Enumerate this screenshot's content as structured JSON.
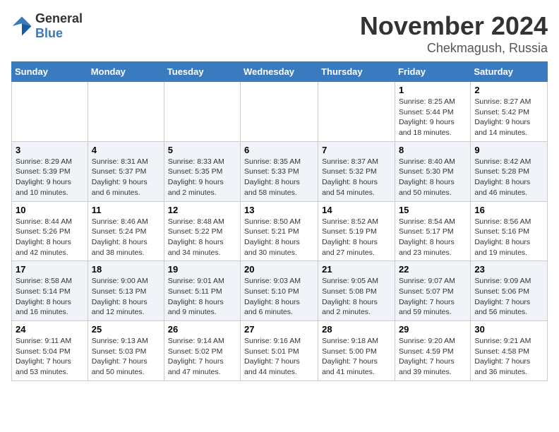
{
  "logo": {
    "general": "General",
    "blue": "Blue"
  },
  "title": {
    "month": "November 2024",
    "location": "Chekmagush, Russia"
  },
  "headers": [
    "Sunday",
    "Monday",
    "Tuesday",
    "Wednesday",
    "Thursday",
    "Friday",
    "Saturday"
  ],
  "weeks": [
    [
      {
        "day": "",
        "info": ""
      },
      {
        "day": "",
        "info": ""
      },
      {
        "day": "",
        "info": ""
      },
      {
        "day": "",
        "info": ""
      },
      {
        "day": "",
        "info": ""
      },
      {
        "day": "1",
        "info": "Sunrise: 8:25 AM\nSunset: 5:44 PM\nDaylight: 9 hours and 18 minutes."
      },
      {
        "day": "2",
        "info": "Sunrise: 8:27 AM\nSunset: 5:42 PM\nDaylight: 9 hours and 14 minutes."
      }
    ],
    [
      {
        "day": "3",
        "info": "Sunrise: 8:29 AM\nSunset: 5:39 PM\nDaylight: 9 hours and 10 minutes."
      },
      {
        "day": "4",
        "info": "Sunrise: 8:31 AM\nSunset: 5:37 PM\nDaylight: 9 hours and 6 minutes."
      },
      {
        "day": "5",
        "info": "Sunrise: 8:33 AM\nSunset: 5:35 PM\nDaylight: 9 hours and 2 minutes."
      },
      {
        "day": "6",
        "info": "Sunrise: 8:35 AM\nSunset: 5:33 PM\nDaylight: 8 hours and 58 minutes."
      },
      {
        "day": "7",
        "info": "Sunrise: 8:37 AM\nSunset: 5:32 PM\nDaylight: 8 hours and 54 minutes."
      },
      {
        "day": "8",
        "info": "Sunrise: 8:40 AM\nSunset: 5:30 PM\nDaylight: 8 hours and 50 minutes."
      },
      {
        "day": "9",
        "info": "Sunrise: 8:42 AM\nSunset: 5:28 PM\nDaylight: 8 hours and 46 minutes."
      }
    ],
    [
      {
        "day": "10",
        "info": "Sunrise: 8:44 AM\nSunset: 5:26 PM\nDaylight: 8 hours and 42 minutes."
      },
      {
        "day": "11",
        "info": "Sunrise: 8:46 AM\nSunset: 5:24 PM\nDaylight: 8 hours and 38 minutes."
      },
      {
        "day": "12",
        "info": "Sunrise: 8:48 AM\nSunset: 5:22 PM\nDaylight: 8 hours and 34 minutes."
      },
      {
        "day": "13",
        "info": "Sunrise: 8:50 AM\nSunset: 5:21 PM\nDaylight: 8 hours and 30 minutes."
      },
      {
        "day": "14",
        "info": "Sunrise: 8:52 AM\nSunset: 5:19 PM\nDaylight: 8 hours and 27 minutes."
      },
      {
        "day": "15",
        "info": "Sunrise: 8:54 AM\nSunset: 5:17 PM\nDaylight: 8 hours and 23 minutes."
      },
      {
        "day": "16",
        "info": "Sunrise: 8:56 AM\nSunset: 5:16 PM\nDaylight: 8 hours and 19 minutes."
      }
    ],
    [
      {
        "day": "17",
        "info": "Sunrise: 8:58 AM\nSunset: 5:14 PM\nDaylight: 8 hours and 16 minutes."
      },
      {
        "day": "18",
        "info": "Sunrise: 9:00 AM\nSunset: 5:13 PM\nDaylight: 8 hours and 12 minutes."
      },
      {
        "day": "19",
        "info": "Sunrise: 9:01 AM\nSunset: 5:11 PM\nDaylight: 8 hours and 9 minutes."
      },
      {
        "day": "20",
        "info": "Sunrise: 9:03 AM\nSunset: 5:10 PM\nDaylight: 8 hours and 6 minutes."
      },
      {
        "day": "21",
        "info": "Sunrise: 9:05 AM\nSunset: 5:08 PM\nDaylight: 8 hours and 2 minutes."
      },
      {
        "day": "22",
        "info": "Sunrise: 9:07 AM\nSunset: 5:07 PM\nDaylight: 7 hours and 59 minutes."
      },
      {
        "day": "23",
        "info": "Sunrise: 9:09 AM\nSunset: 5:06 PM\nDaylight: 7 hours and 56 minutes."
      }
    ],
    [
      {
        "day": "24",
        "info": "Sunrise: 9:11 AM\nSunset: 5:04 PM\nDaylight: 7 hours and 53 minutes."
      },
      {
        "day": "25",
        "info": "Sunrise: 9:13 AM\nSunset: 5:03 PM\nDaylight: 7 hours and 50 minutes."
      },
      {
        "day": "26",
        "info": "Sunrise: 9:14 AM\nSunset: 5:02 PM\nDaylight: 7 hours and 47 minutes."
      },
      {
        "day": "27",
        "info": "Sunrise: 9:16 AM\nSunset: 5:01 PM\nDaylight: 7 hours and 44 minutes."
      },
      {
        "day": "28",
        "info": "Sunrise: 9:18 AM\nSunset: 5:00 PM\nDaylight: 7 hours and 41 minutes."
      },
      {
        "day": "29",
        "info": "Sunrise: 9:20 AM\nSunset: 4:59 PM\nDaylight: 7 hours and 39 minutes."
      },
      {
        "day": "30",
        "info": "Sunrise: 9:21 AM\nSunset: 4:58 PM\nDaylight: 7 hours and 36 minutes."
      }
    ]
  ]
}
